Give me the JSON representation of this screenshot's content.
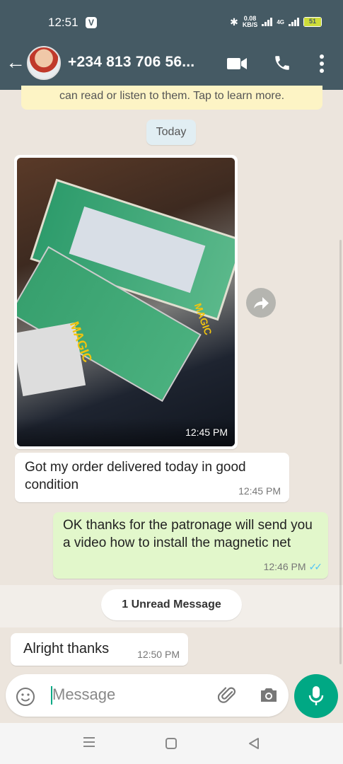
{
  "status_bar": {
    "time": "12:51",
    "speed_value": "0.08",
    "speed_unit": "KB/S",
    "network": "4G",
    "battery": "51"
  },
  "header": {
    "contact_name": "+234 813 706 56..."
  },
  "chat": {
    "encryption_notice": "can read or listen to them. Tap to learn more.",
    "day_label": "Today",
    "image_message": {
      "time": "12:45 PM"
    },
    "messages": [
      {
        "direction": "in",
        "text": "Got my order delivered today in good condition",
        "time": "12:45 PM"
      },
      {
        "direction": "out",
        "text": "OK thanks for the patronage will send you a video how to install the magnetic net",
        "time": "12:46 PM",
        "status": "read"
      },
      {
        "direction": "in",
        "text": "Alright thanks",
        "time": "12:50 PM"
      }
    ],
    "unread_label": "1 Unread Message"
  },
  "composer": {
    "placeholder": "Message"
  },
  "colors": {
    "header_bg": "#455a64",
    "outgoing_bubble": "#e2f7cb",
    "accent": "#00a884",
    "read_ticks": "#4fc3f7"
  }
}
